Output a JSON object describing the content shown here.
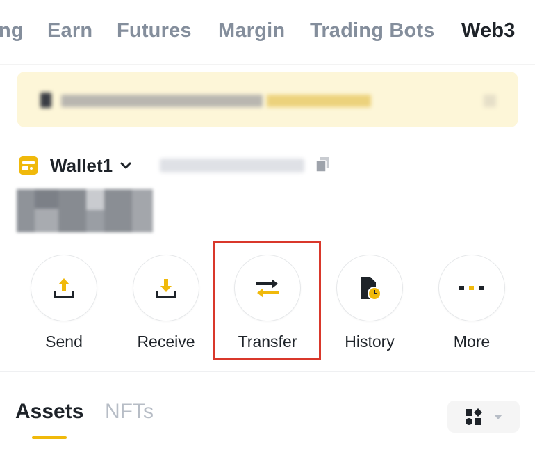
{
  "nav": {
    "tabs": [
      {
        "label": "ng"
      },
      {
        "label": "Earn"
      },
      {
        "label": "Futures"
      },
      {
        "label": "Margin"
      },
      {
        "label": "Trading Bots"
      },
      {
        "label": "Web3",
        "active": true
      }
    ]
  },
  "wallet": {
    "name": "Wallet1"
  },
  "actions": [
    {
      "label": "Send",
      "icon": "upload-icon"
    },
    {
      "label": "Receive",
      "icon": "download-icon"
    },
    {
      "label": "Transfer",
      "icon": "transfer-arrows-icon"
    },
    {
      "label": "History",
      "icon": "history-icon"
    },
    {
      "label": "More",
      "icon": "more-dots-icon"
    }
  ],
  "asset_tabs": [
    {
      "label": "Assets",
      "active": true
    },
    {
      "label": "NFTs"
    }
  ],
  "colors": {
    "accent": "#f0b90b",
    "text_primary": "#1e2329",
    "text_secondary": "#848e9c",
    "highlight_box": "#d9382b",
    "banner_bg": "#fdf6d8"
  }
}
